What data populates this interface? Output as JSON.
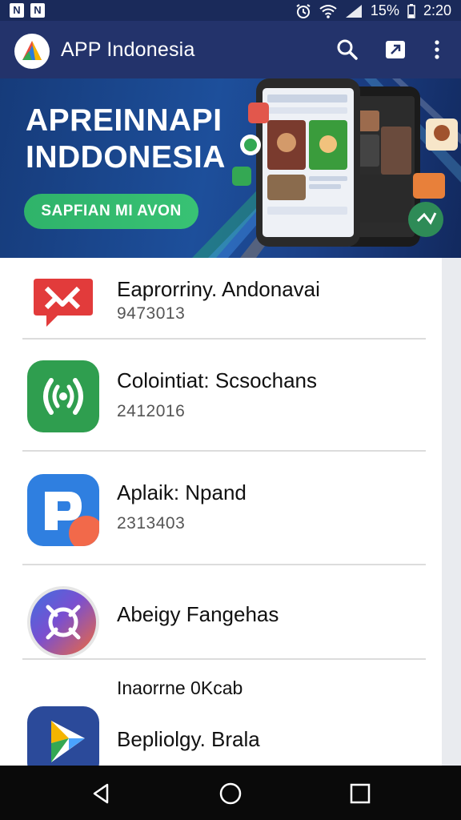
{
  "status_bar": {
    "left_icons": [
      "N",
      "N"
    ],
    "battery_percent": "15%",
    "time": "2:20",
    "icons": [
      "alarm-icon",
      "wifi-icon",
      "signal-icon",
      "battery-icon"
    ]
  },
  "app_bar": {
    "title": "APP Indonesia",
    "icons": [
      "search-icon",
      "share-icon",
      "more-icon"
    ],
    "color": "#23336b"
  },
  "banner": {
    "title_line1": "APREINNAPI",
    "title_line2": "INDDONESIA",
    "button_label": "SAPFIAN MI AVON",
    "button_color": "#2fb36a"
  },
  "app_list": [
    {
      "name": "Eaprorriny. Andonavai",
      "code": "9473013",
      "icon": "red-chat-icon"
    },
    {
      "name": "Colointiat: Scsochans",
      "code": "2412016",
      "icon": "green-broadcast-icon"
    },
    {
      "name": "Aplaik: Npand",
      "code": "2313403",
      "icon": "blue-p-icon"
    },
    {
      "name": "Abeigy Fangehas",
      "code": "",
      "icon": "gradient-circle-icon"
    },
    {
      "name": "Bepliolgy. Brala",
      "code": "",
      "icon": "play-arrow-icon"
    }
  ],
  "section_header": "Inaorrne 0Kcab",
  "nav_bar": {
    "buttons": [
      "back-icon",
      "home-icon",
      "recents-icon"
    ]
  }
}
